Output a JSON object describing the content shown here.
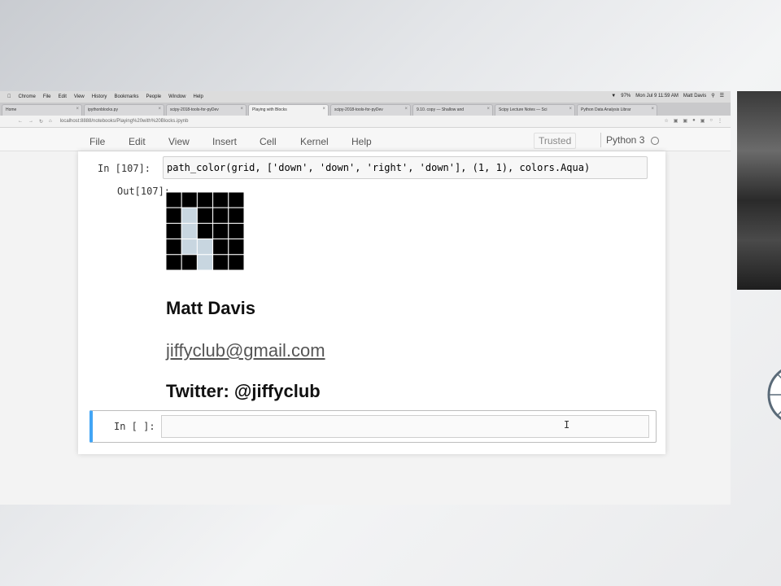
{
  "mac_menubar": {
    "items": [
      "Chrome",
      "File",
      "Edit",
      "View",
      "History",
      "Bookmarks",
      "People",
      "Window",
      "Help"
    ],
    "clock": "Mon Jul 9 11:59 AM",
    "user": "Matt Davis",
    "battery": "97%"
  },
  "tabs": [
    {
      "label": "Home",
      "active": false
    },
    {
      "label": "ipythonblocks.py",
      "active": false
    },
    {
      "label": "scipy-2018-tools-for-pyDev",
      "active": false
    },
    {
      "label": "Playing with Blocks",
      "active": true
    },
    {
      "label": "scipy-2018-tools-for-pyDev",
      "active": false
    },
    {
      "label": "9.10. copy — Shallow and",
      "active": false
    },
    {
      "label": "Scipy Lecture Notes — Sci",
      "active": false
    },
    {
      "label": "Python Data Analysis Librar",
      "active": false
    }
  ],
  "addressbar": {
    "url": "localhost:8888/notebooks/Playing%20with%20Blocks.ipynb"
  },
  "nb_menu": [
    "File",
    "Edit",
    "View",
    "Insert",
    "Cell",
    "Kernel",
    "Help"
  ],
  "trusted": "Trusted",
  "kernel_name": "Python 3",
  "cells": {
    "in_prompt": "In [107]:",
    "code": "path_color(grid, ['down', 'down', 'right', 'down'], (1, 1), colors.Aqua)",
    "out_prompt": "Out[107]:",
    "grid": {
      "rows": 5,
      "cols": 5,
      "path_color": "#c8d6e0",
      "block_color": "#000000",
      "path": [
        [
          1,
          1
        ],
        [
          2,
          1
        ],
        [
          3,
          1
        ],
        [
          3,
          2
        ],
        [
          4,
          2
        ]
      ]
    },
    "name": "Matt Davis",
    "email": "jiffyclub@gmail.com",
    "twitter": "Twitter: @jiffyclub",
    "empty_prompt": "In [ ]:"
  }
}
